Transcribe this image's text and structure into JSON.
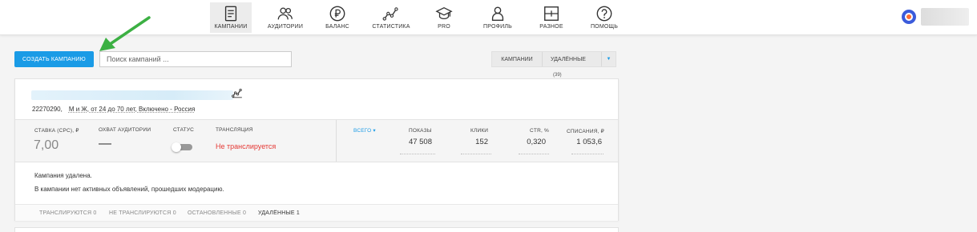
{
  "nav": [
    {
      "label": "КАМПАНИИ",
      "icon": "campaigns-icon"
    },
    {
      "label": "АУДИТОРИИ",
      "icon": "audiences-icon"
    },
    {
      "label": "БАЛАНС",
      "icon": "balance-icon"
    },
    {
      "label": "СТАТИСТИКА",
      "icon": "statistics-icon"
    },
    {
      "label": "PRO",
      "icon": "pro-icon"
    },
    {
      "label": "ПРОФИЛЬ",
      "icon": "profile-icon"
    },
    {
      "label": "РАЗНОЕ",
      "icon": "misc-icon"
    },
    {
      "label": "ПОМОЩЬ",
      "icon": "help-icon"
    }
  ],
  "toolbar": {
    "create_label": "СОЗДАТЬ КАМПАНИЮ",
    "search_placeholder": "Поиск кампаний ..."
  },
  "filter": {
    "campaigns_label": "КАМПАНИИ",
    "deleted_label": "УДАЛЁННЫЕ",
    "deleted_count": "(39)"
  },
  "campaign": {
    "id": "22270290,",
    "description": "М и Ж, от 24 до 70 лет, Включено - Россия",
    "stats": {
      "rate_label": "СТАВКА (CPC), ₽",
      "rate_value": "7,00",
      "reach_label": "ОХВАТ АУДИТОРИИ",
      "reach_value": "—",
      "status_label": "СТАТУС",
      "broadcast_label": "ТРАНСЛЯЦИЯ",
      "broadcast_value": "Не транслируется",
      "period_label": "ВСЕГО",
      "impressions_label": "ПОКАЗЫ",
      "impressions_value": "47 508",
      "clicks_label": "КЛИКИ",
      "clicks_value": "152",
      "ctr_label": "CTR, %",
      "ctr_value": "0,320",
      "spend_label": "СПИСАНИЯ, ₽",
      "spend_value": "1 053,6"
    },
    "notes": [
      "Кампания удалена.",
      "В кампании нет активных объявлений, прошедших модерацию."
    ],
    "tabs": [
      "ТРАНСЛИРУЮТСЯ 0",
      "НЕ ТРАНСЛИРУЮТСЯ 0",
      "ОСТАНОВЛЕННЫЕ 0",
      "УДАЛЁННЫЕ 1"
    ]
  },
  "colors": {
    "accent": "#1a9be6",
    "error": "#e53935",
    "arrow": "#3cb043"
  }
}
